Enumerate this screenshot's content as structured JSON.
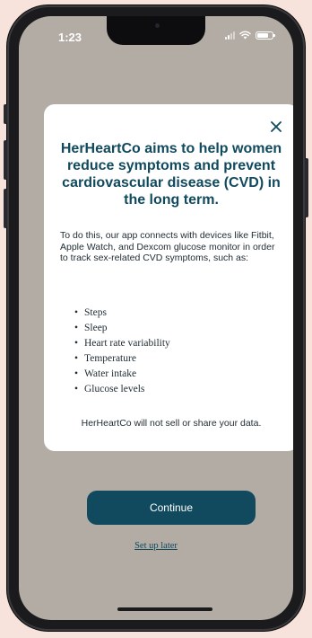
{
  "status_bar": {
    "time": "1:23"
  },
  "modal": {
    "close_icon": "close-icon",
    "title": "HerHeartCo aims to help women reduce symptoms and prevent cardiovascular disease (CVD) in the long term.",
    "description": "To do this, our app connects with devices like Fitbit, Apple Watch, and Dexcom glucose monitor in order to track sex-related CVD symptoms, such as:",
    "symptoms": [
      "Steps",
      "Sleep",
      "Heart rate variability",
      "Temperature",
      "Water intake",
      "Glucose levels"
    ],
    "footnote": "HerHeartCo will not sell or share your data."
  },
  "actions": {
    "continue_label": "Continue",
    "setup_later_label": "Set up later"
  },
  "colors": {
    "accent": "#114a5e",
    "screen_bg": "#b3aca4",
    "page_bg": "#f7e3db"
  }
}
